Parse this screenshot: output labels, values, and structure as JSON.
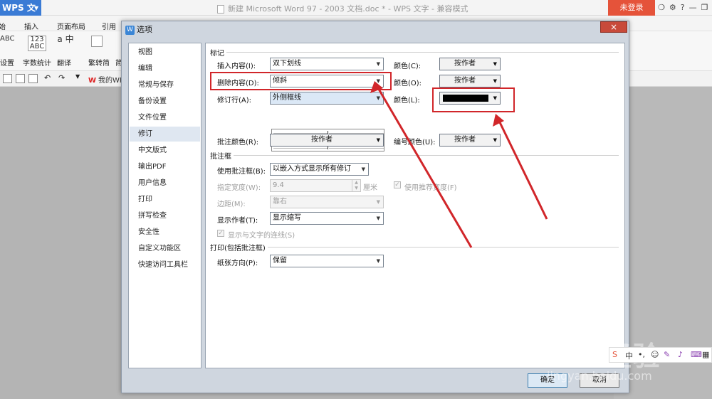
{
  "app": {
    "name": "WPS 文字",
    "doc_title": "新建 Microsoft Word 97 - 2003 文档.doc * - WPS 文字 - 兼容模式",
    "login_label": "未登录"
  },
  "menu": [
    "插入",
    "页面布局",
    "引用"
  ],
  "ribbon": {
    "labels": [
      "设置",
      "字数统计",
      "翻译",
      "繁转简",
      "简"
    ],
    "icon_text": [
      "ABC",
      "123 ABC",
      "a 中"
    ]
  },
  "qat": {
    "my_wps": "我的WPS"
  },
  "dialog": {
    "title": "选项",
    "close": "×",
    "nav": [
      "视图",
      "编辑",
      "常规与保存",
      "备份设置",
      "文件位置",
      "修订",
      "中文版式",
      "输出PDF",
      "用户信息",
      "打印",
      "拼写检查",
      "安全性",
      "自定义功能区",
      "快速访问工具栏"
    ],
    "nav_selected": "修订",
    "markup": {
      "section": "标记",
      "insert_label": "插入内容(I):",
      "insert_value": "双下划线",
      "delete_label": "删除内容(D):",
      "delete_value": "倾斜",
      "revline_label": "修订行(A):",
      "revline_value": "外侧框线",
      "color_c_label": "颜色(C):",
      "color_c_value": "按作者",
      "color_o_label": "颜色(O):",
      "color_o_value": "按作者",
      "color_l_label": "颜色(L):",
      "color_l_swatch": "#000000",
      "comment_color_label": "批注颜色(R):",
      "comment_color_value": "按作者",
      "numbering_color_label": "编号颜色(U):",
      "numbering_color_value": "按作者"
    },
    "balloon": {
      "section": "批注框",
      "use_label": "使用批注框(B):",
      "use_value": "以嵌入方式显示所有修订",
      "width_label": "指定宽度(W):",
      "width_value": "9.4",
      "width_unit": "厘米",
      "recommended_label": "使用推荐宽度(F)",
      "recommended_checked": true,
      "margin_label": "边距(M):",
      "margin_value": "靠右",
      "author_label": "显示作者(T):",
      "author_value": "显示缩写",
      "connect_label": "显示与文字的连线(S)",
      "connect_checked": true
    },
    "print": {
      "section": "打印(包括批注框)",
      "orientation_label": "纸张方向(P):",
      "orientation_value": "保留"
    },
    "ok": "确定",
    "cancel": "取消"
  },
  "watermark": {
    "logo": "Bai 经验",
    "url": "jingyan.baidu.com"
  },
  "colors": {
    "annotation_red": "#d1262a",
    "wps_blue": "#3a7bd5",
    "login_red": "#e5533a"
  }
}
